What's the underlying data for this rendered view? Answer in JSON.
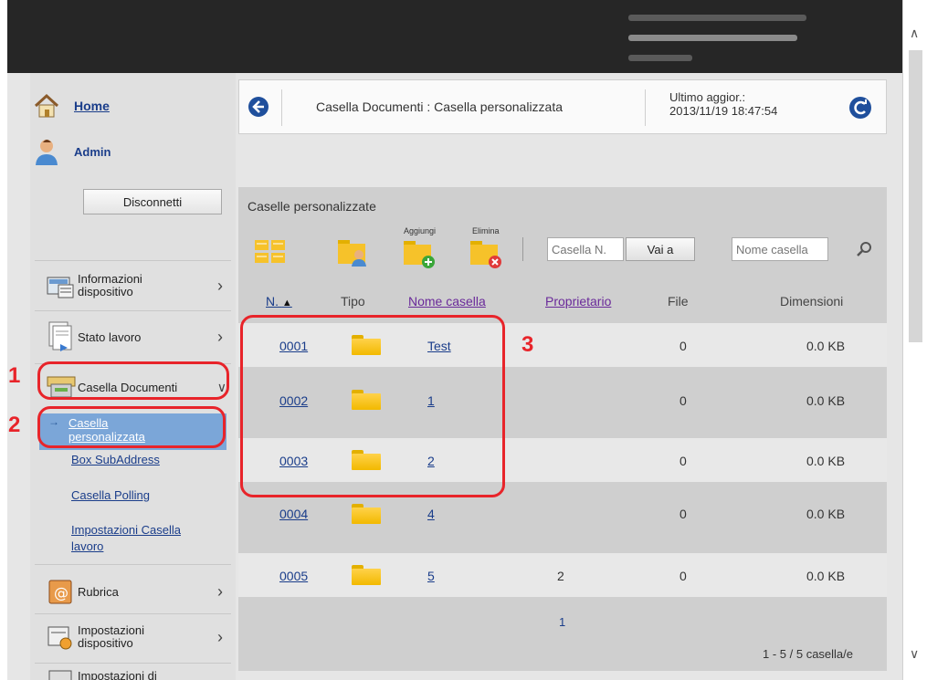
{
  "sidebar": {
    "home": "Home",
    "user": "Admin",
    "logout": "Disconnetti",
    "items": [
      {
        "label": "Informazioni",
        "label2": "dispositivo"
      },
      {
        "label": "Stato lavoro"
      },
      {
        "label": "Casella Documenti"
      },
      {
        "label": "Rubrica"
      },
      {
        "label": "Impostazioni",
        "label2": "dispositivo"
      },
      {
        "label": "Impostazioni di"
      }
    ],
    "submenu": {
      "selected1": "Casella",
      "selected2": "personalizzata",
      "box_subaddress": "Box SubAddress",
      "polling": "Casella Polling",
      "job_box1": "Impostazioni Casella",
      "job_box2": "lavoro"
    }
  },
  "header": {
    "breadcrumb": "Casella Documenti : Casella personalizzata",
    "last_update_label": "Ultimo aggior.:",
    "last_update_value": "2013/11/19 18:47:54"
  },
  "panel": {
    "title": "Caselle personalizzate",
    "toolbar": {
      "add": "Aggiungi",
      "delete": "Elimina",
      "box_no_placeholder": "Casella N.",
      "goto": "Vai a",
      "name_placeholder": "Nome casella"
    },
    "columns": {
      "no": "N.",
      "sort": "▲",
      "type": "Tipo",
      "name": "Nome casella",
      "owner": "Proprietario",
      "files": "File",
      "size": "Dimensioni"
    },
    "rows": [
      {
        "no": "0001",
        "name": "Test",
        "owner": "",
        "files": "0",
        "size": "0.0 KB"
      },
      {
        "no": "0002",
        "name": "1",
        "owner": "",
        "files": "0",
        "size": "0.0 KB"
      },
      {
        "no": "0003",
        "name": "2",
        "owner": "",
        "files": "0",
        "size": "0.0 KB"
      },
      {
        "no": "0004",
        "name": "4",
        "owner": "",
        "files": "0",
        "size": "0.0 KB"
      },
      {
        "no": "0005",
        "name": "5",
        "owner": "2",
        "files": "0",
        "size": "0.0 KB"
      }
    ],
    "page": "1",
    "count": "1 - 5 / 5 casella/e"
  },
  "callouts": {
    "one": "1",
    "two": "2",
    "three": "3"
  },
  "colors": {
    "callout": "#e8242a",
    "link": "#1a3d8a",
    "folder": "#f2b900",
    "selected": "#7ba6d8"
  }
}
